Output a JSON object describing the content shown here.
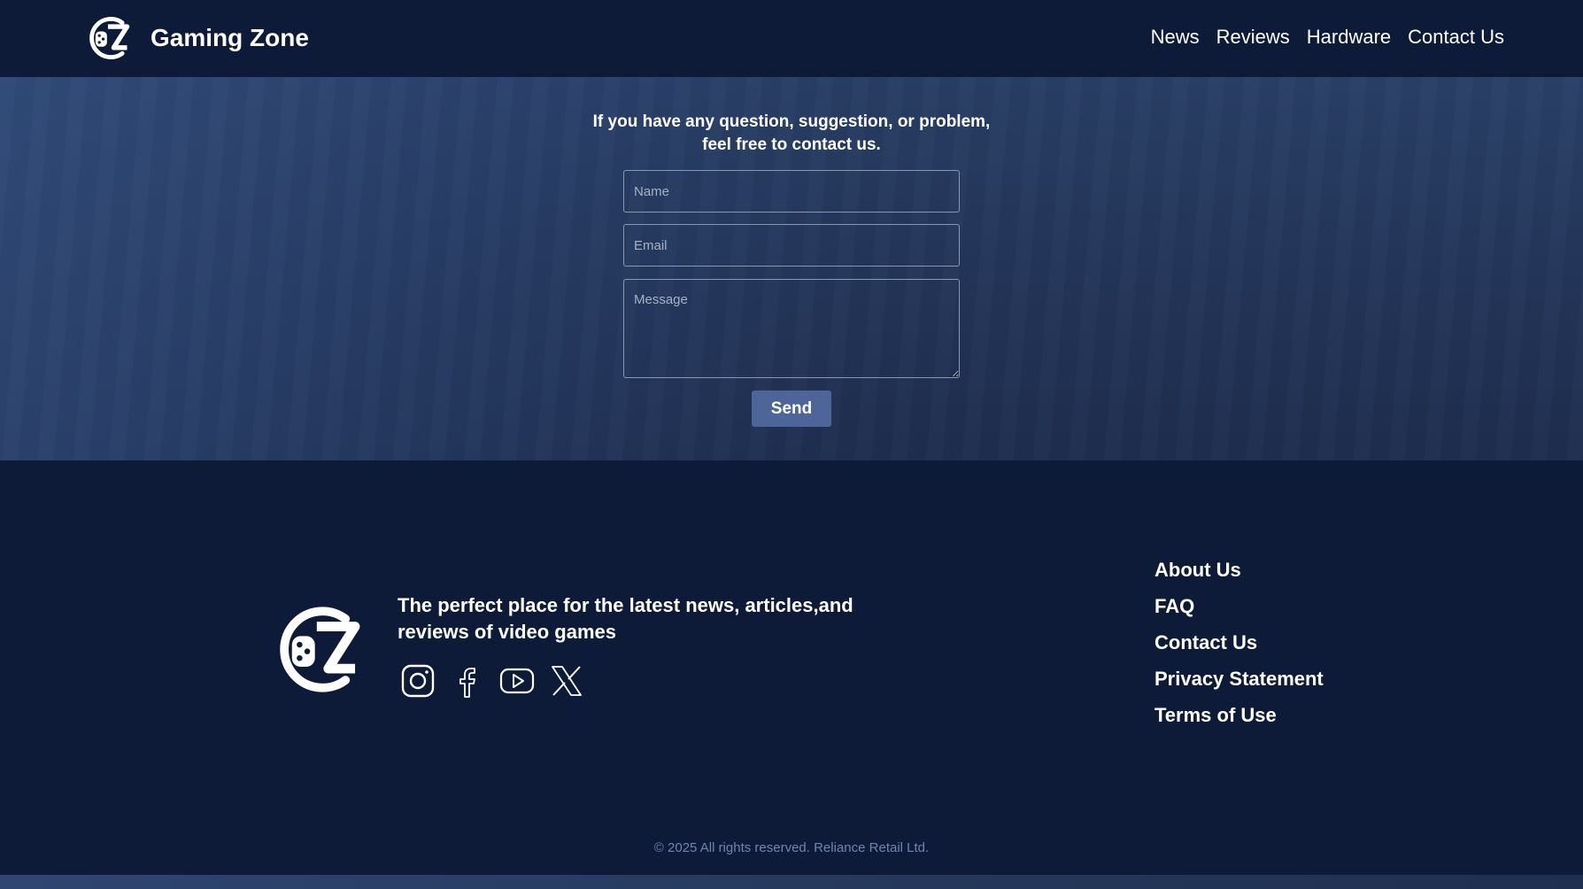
{
  "header": {
    "brand_name": "Gaming Zone",
    "logo_icon": "gz-gamepad-logo-icon",
    "nav": [
      {
        "label": "News"
      },
      {
        "label": "Reviews"
      },
      {
        "label": "Hardware"
      },
      {
        "label": "Contact Us"
      }
    ]
  },
  "contact": {
    "intro_line1": "If you have any question, suggestion, or problem,",
    "intro_line2": "feel free to contact us.",
    "name_placeholder": "Name",
    "email_placeholder": "Email",
    "message_placeholder": "Message",
    "send_label": "Send",
    "send_color": "#4d6598"
  },
  "footer": {
    "logo_icon": "gz-gamepad-logo-icon",
    "tagline_line1": "The perfect place for the latest news, articles,and",
    "tagline_line2": "reviews of video games",
    "socials": [
      {
        "icon": "instagram-icon"
      },
      {
        "icon": "facebook-icon"
      },
      {
        "icon": "youtube-icon"
      },
      {
        "icon": "x-icon"
      }
    ],
    "links": [
      {
        "label": "About Us"
      },
      {
        "label": "FAQ"
      },
      {
        "label": "Contact Us"
      },
      {
        "label": "Privacy Statement"
      },
      {
        "label": "Terms of Use"
      }
    ],
    "copyright": "© 2025 All rights reserved. Reliance Retail Ltd."
  },
  "colors": {
    "background": "#0e1b38",
    "hero": "#2a4068",
    "copyright_text": "#6f84b3"
  }
}
